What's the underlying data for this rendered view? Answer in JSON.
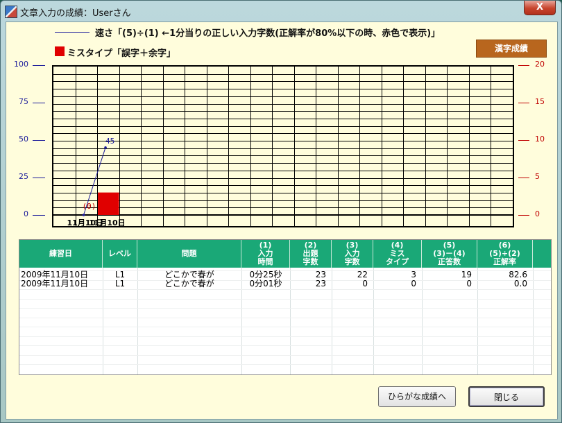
{
  "window": {
    "title": "文章入力の成績：Userさん",
    "close_label": "X"
  },
  "legend": {
    "speed_text": "速さ「(5)÷(1) ←1分当りの正しい入力字数(正解率が80%以下の時、赤色で表示)」",
    "miss_text": "ミスタイプ「誤字＋余字」",
    "miss_color": "#e00000",
    "speed_color": "#1a1a9a"
  },
  "buttons": {
    "kanji": "漢字成績",
    "hiragana": "ひらがな成績へ",
    "close": "閉じる"
  },
  "chart_data": {
    "type": "line",
    "left_axis": {
      "ticks": [
        "100",
        "75",
        "50",
        "25",
        "0"
      ],
      "ylim": [
        0,
        100
      ]
    },
    "right_axis": {
      "ticks": [
        "20",
        "15",
        "10",
        "5",
        "0"
      ],
      "ylim": [
        0,
        20
      ]
    },
    "categories": [
      "11月10日",
      "11月10日"
    ],
    "series": [
      {
        "values": [
          0,
          45
        ],
        "labels": [
          "(0)",
          "45"
        ]
      },
      {
        "type": "bar",
        "axis": "right",
        "values": [
          0,
          3
        ]
      }
    ]
  },
  "table": {
    "headers": [
      "練習日",
      "レベル",
      "問題",
      "(1)\n入力\n時間",
      "(2)\n出題\n字数",
      "(3)\n入力\n字数",
      "(4)\nミス\nタイプ",
      "(5)\n(3)－(4)\n正答数",
      "(6)\n(5)÷(2)\n正解率"
    ],
    "rows": [
      [
        "2009年11月10日",
        "L1",
        "どこかで春が",
        "0分25秒",
        "23",
        "22",
        "3",
        "19",
        "82.6"
      ],
      [
        "2009年11月10日",
        "L1",
        "どこかで春が",
        "0分01秒",
        "23",
        "0",
        "0",
        "0",
        "0.0"
      ]
    ]
  }
}
